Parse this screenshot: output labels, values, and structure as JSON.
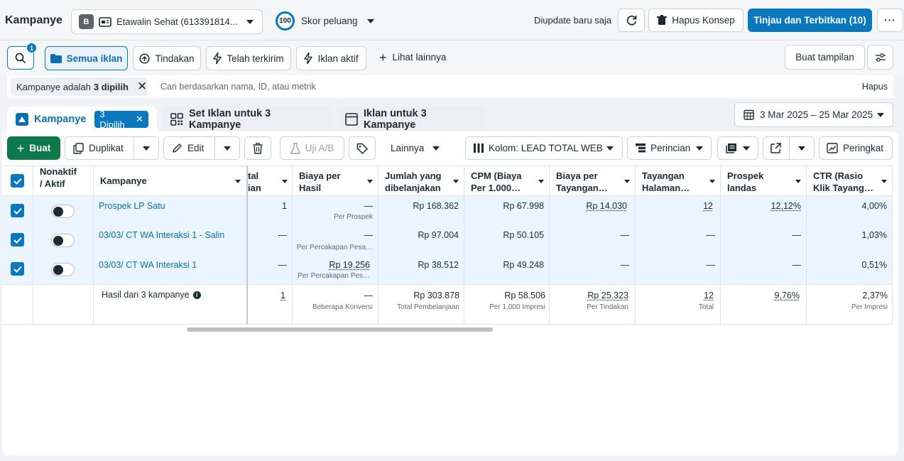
{
  "header": {
    "title": "Kampanye",
    "account_badge": "B",
    "account_name": "Etawalin Sehat (613391814...",
    "score_value": "100",
    "score_label": "Skor peluang",
    "update_status": "Diupdate baru saja",
    "delete_draft_label": "Hapus Konsep",
    "publish_label": "Tinjau dan Terbitkan (10)"
  },
  "filters": {
    "search_badge": "1",
    "tabs": [
      "Semua iklan",
      "Tindakan",
      "Telah terkirim",
      "Iklan aktif",
      "Lihat lainnya"
    ],
    "create_view_label": "Buat tampilan",
    "chip_prefix": "Kampanye adalah",
    "chip_bold": "3 dipilih",
    "search_placeholder": "Cari berdasarkan nama, ID, atau metrik",
    "clear_label": "Hapus"
  },
  "level_tabs": {
    "campaigns": "Kampanye",
    "selected_badge": "3 Dipilih",
    "adsets": "Set Iklan untuk 3 Kampanye",
    "ads": "Iklan untuk 3 Kampanye",
    "date_range": "3 Mar 2025 – 25 Mar 2025"
  },
  "toolbar": {
    "create": "Buat",
    "duplicate": "Duplikat",
    "edit": "Edit",
    "ab_test": "Uji A/B",
    "more": "Lainnya",
    "columns": "Kolom: LEAD TOTAL WEB",
    "breakdown": "Perincian",
    "reports": "Peringkat"
  },
  "table": {
    "headers": {
      "toggle": [
        "Nonaktif",
        "/ Aktif"
      ],
      "name": "Kampanye",
      "results": [
        "tal",
        "ian"
      ],
      "cost_per_result": [
        "Biaya per",
        "Hasil"
      ],
      "spent": [
        "Jumlah yang",
        "dibelanjakan"
      ],
      "cpm": [
        "CPM (Biaya",
        "Per 1.000…"
      ],
      "cost_per_view": [
        "Biaya per",
        "Tayangan…"
      ],
      "page_views": [
        "Tayangan",
        "Halaman…"
      ],
      "leads": [
        "Prospek",
        "landas"
      ],
      "ctr": [
        "CTR (Rasio",
        "Klik Tayang…"
      ]
    },
    "rows": [
      {
        "name": "Prospek LP Satu",
        "results": "1",
        "cost_per_result": "—",
        "cost_sub": "Per Prospek",
        "spent": "Rp 168.362",
        "cpm": "Rp 67.998",
        "cost_per_view": "Rp 14.030",
        "page_views": "12",
        "leads": "12,12%",
        "ctr": "4,00%"
      },
      {
        "name": "03/03/ CT WA Interaksi 1 - Salin",
        "results": "—",
        "cost_per_result": "—",
        "cost_sub": "Per Percakapan Pesa…",
        "spent": "Rp 97.004",
        "cpm": "Rp 50.105",
        "cost_per_view": "—",
        "page_views": "—",
        "leads": "—",
        "ctr": "1,03%"
      },
      {
        "name": "03/03/ CT WA Interaksi 1",
        "results": "—",
        "cost_per_result": "Rp 19.256",
        "cost_sub": "Per Percakapan Pes…",
        "spent": "Rp 38.512",
        "cpm": "Rp 49.248",
        "cost_per_view": "—",
        "page_views": "—",
        "leads": "—",
        "ctr": "0,51%"
      }
    ],
    "summary": {
      "label": "Hasil dari 3 kampanye",
      "results": "1",
      "cost_per_result": "—",
      "cost_sub": "Beberapa Konversi",
      "spent": "Rp 303.878",
      "spent_sub": "Total Pembelanjaan",
      "cpm": "Rp 58.506",
      "cpm_sub": "Per 1.000 Impresi",
      "cost_per_view": "Rp 25.323",
      "cost_per_view_sub": "Per Tindakan",
      "page_views": "12",
      "page_views_sub": "Total",
      "leads": "9,76%",
      "ctr": "2,37%",
      "ctr_sub": "Per Impresi"
    }
  },
  "colors": {
    "primary": "#0a78be",
    "create_green": "#0e7a4c",
    "row_selected": "#ebf5ff"
  }
}
